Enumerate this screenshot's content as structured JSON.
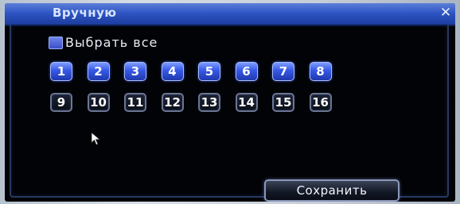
{
  "dialog": {
    "title": "Вручную",
    "close_glyph": "✕"
  },
  "select_all": {
    "label": "Выбрать все",
    "checked": true
  },
  "channels": [
    {
      "label": "1",
      "selected": true
    },
    {
      "label": "2",
      "selected": true
    },
    {
      "label": "3",
      "selected": true
    },
    {
      "label": "4",
      "selected": true
    },
    {
      "label": "5",
      "selected": true
    },
    {
      "label": "6",
      "selected": true
    },
    {
      "label": "7",
      "selected": true
    },
    {
      "label": "8",
      "selected": true
    },
    {
      "label": "9",
      "selected": false
    },
    {
      "label": "10",
      "selected": false
    },
    {
      "label": "11",
      "selected": false
    },
    {
      "label": "12",
      "selected": false
    },
    {
      "label": "13",
      "selected": false
    },
    {
      "label": "14",
      "selected": false
    },
    {
      "label": "15",
      "selected": false
    },
    {
      "label": "16",
      "selected": false
    }
  ],
  "save_button": {
    "label": "Сохранить"
  },
  "colors": {
    "title_bar": "#2f56c4",
    "channel_selected": "#3658e6",
    "channel_unselected": "#0a0e18",
    "background": "#020306"
  },
  "icons": {
    "close": "close-icon",
    "pointer": "mouse-pointer-icon"
  }
}
